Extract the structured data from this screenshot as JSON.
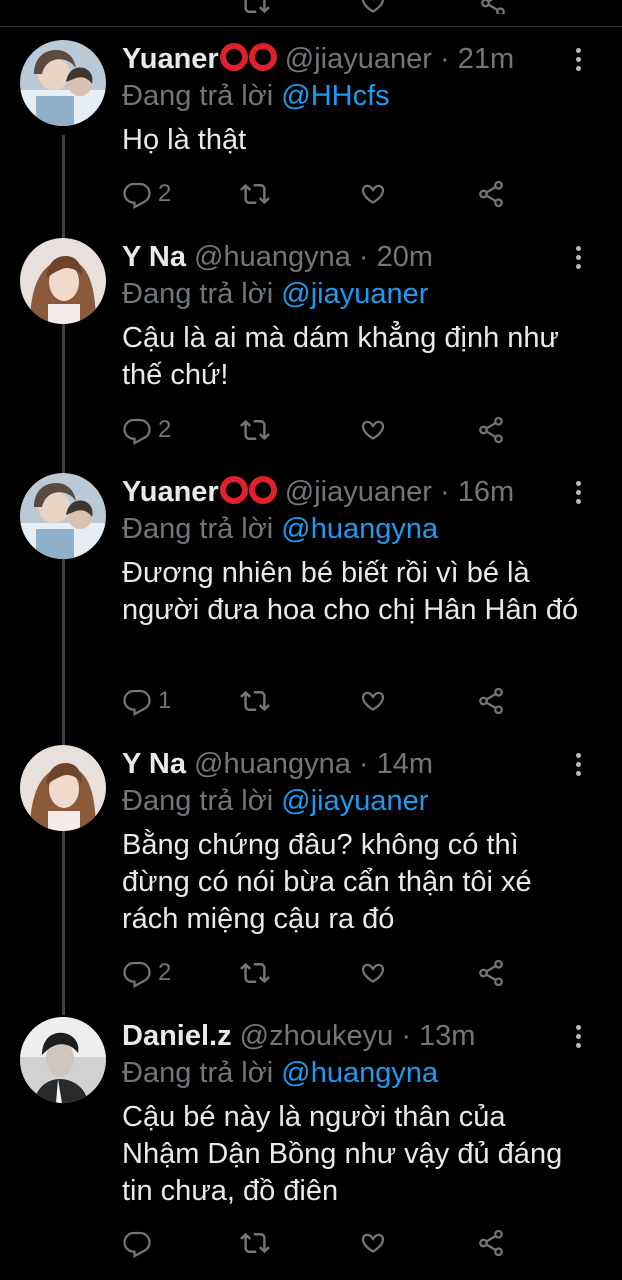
{
  "tweets": [
    {
      "name": "Yuaner",
      "handle": "@jiayuaner",
      "time": "21m",
      "reply_label": "Đang trả lời",
      "reply_to": "@HHcfs",
      "text": "Họ là thật",
      "replies": "2",
      "avatar": "avatar-yuaner"
    },
    {
      "name": "Y Na",
      "handle": "@huangyna",
      "time": "20m",
      "reply_label": "Đang trả lời",
      "reply_to": "@jiayuaner",
      "text": "Cậu là ai mà dám khẳng định như thế chứ!",
      "replies": "2",
      "avatar": "avatar-yna"
    },
    {
      "name": "Yuaner",
      "handle": "@jiayuaner",
      "time": "16m",
      "reply_label": "Đang trả lời",
      "reply_to": "@huangyna",
      "text": "Đương nhiên bé biết rồi vì bé là người đưa hoa cho chị Hân Hân đó",
      "replies": "1",
      "avatar": "avatar-yuaner"
    },
    {
      "name": "Y Na",
      "handle": "@huangyna",
      "time": "14m",
      "reply_label": "Đang trả lời",
      "reply_to": "@jiayuaner",
      "text": "Bằng chứng đâu? không có thì đừng có nói bừa cẩn thận tôi xé rách miệng cậu ra đó",
      "replies": "2",
      "avatar": "avatar-yna"
    },
    {
      "name": "Daniel.z",
      "handle": "@zhoukeyu",
      "time": "13m",
      "reply_label": "Đang trả lời",
      "reply_to": "@huangyna",
      "text": "Cậu bé này là người thân của Nhậm Dận Bồng như vậy đủ đáng tin chưa, đồ điên",
      "replies": "",
      "avatar": "avatar-daniel"
    }
  ],
  "separator": "·",
  "icons": {
    "reply": "reply-icon",
    "retweet": "retweet-icon",
    "like": "like-icon",
    "share": "share-icon",
    "more": "more-icon",
    "name_emoji": "red-ring-emoji"
  },
  "colors": {
    "background": "#000000",
    "text": "#e7e9ea",
    "secondary": "#71767b",
    "link": "#1d9bf0",
    "thread_line": "#3d4248"
  }
}
